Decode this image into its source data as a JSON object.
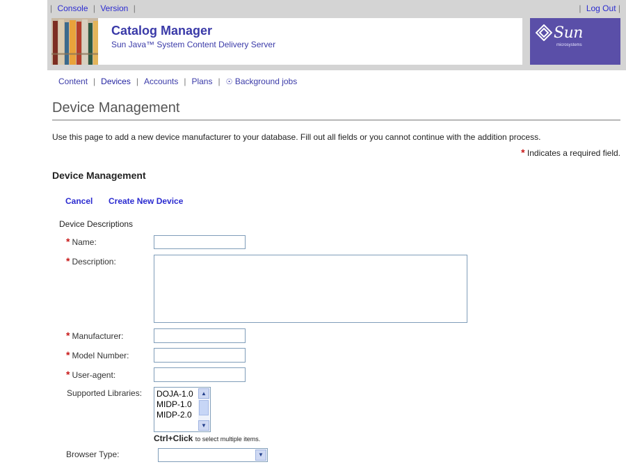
{
  "utility": {
    "console": "Console",
    "version": "Version",
    "logout": "Log Out",
    "sep": "|"
  },
  "banner": {
    "title": "Catalog Manager",
    "subtitle": "Sun Java™ System Content Delivery Server",
    "logo_text": "Sun",
    "logo_sub": "microsystems"
  },
  "tabs": [
    {
      "label": "Content"
    },
    {
      "label": "Devices",
      "active": true
    },
    {
      "label": "Accounts"
    },
    {
      "label": "Plans"
    },
    {
      "label": "Background jobs",
      "icon": "globe-icon"
    }
  ],
  "page": {
    "title": "Device Management",
    "help": "Use this page to add a new device manufacturer to your database. Fill out all fields or you cannot continue with the addition process.",
    "required_star": "*",
    "required_note": "Indicates a required field."
  },
  "section": {
    "title": "Device Management",
    "cancel": "Cancel",
    "create": "Create New Device",
    "subheading": "Device Descriptions"
  },
  "form": {
    "name_label": "Name:",
    "description_label": "Description:",
    "manufacturer_label": "Manufacturer:",
    "model_label": "Model Number:",
    "useragent_label": "User-agent:",
    "libraries_label": "Supported Libraries:",
    "libraries": [
      "DOJA-1.0",
      "MIDP-1.0",
      "MIDP-2.0"
    ],
    "ctrl_bold": "Ctrl+Click",
    "ctrl_rest": "to select multiple items.",
    "browser_label": "Browser Type:",
    "browser_value": ""
  }
}
